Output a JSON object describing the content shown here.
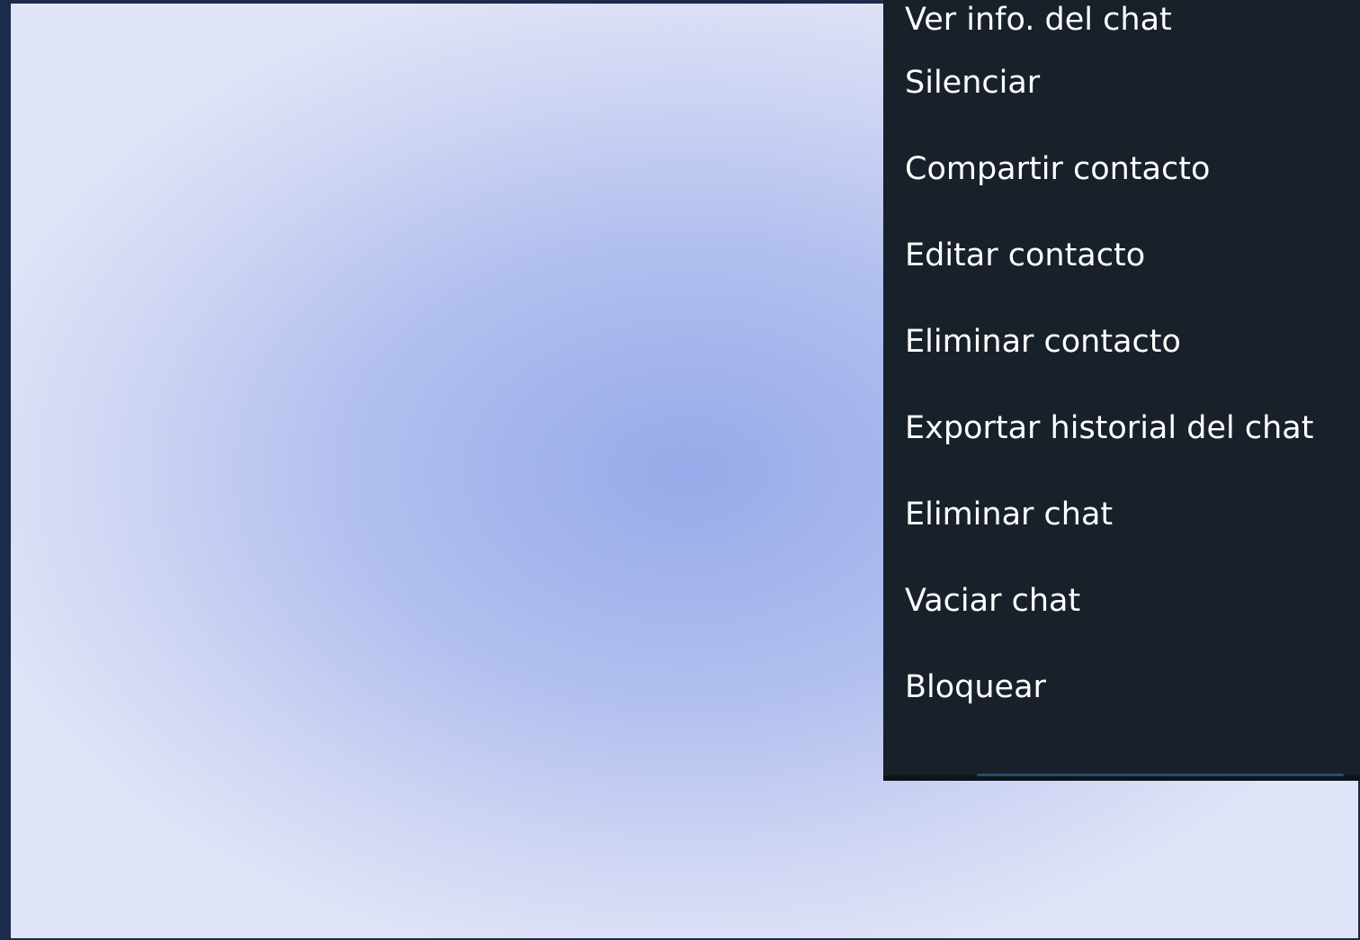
{
  "menu": {
    "items": [
      {
        "label": "Ver info. del chat"
      },
      {
        "label": "Silenciar"
      },
      {
        "label": "Compartir contacto"
      },
      {
        "label": "Editar contacto"
      },
      {
        "label": "Eliminar contacto"
      },
      {
        "label": "Exportar historial del chat"
      },
      {
        "label": "Eliminar chat"
      },
      {
        "label": "Vaciar chat"
      },
      {
        "label": "Bloquear"
      }
    ]
  },
  "colors": {
    "menu_background": "#18202a",
    "menu_text": "#ffffff",
    "chat_gradient_center": "#97aae9",
    "chat_gradient_edge": "#e0e4f7",
    "window_border": "#1c2b4a"
  }
}
